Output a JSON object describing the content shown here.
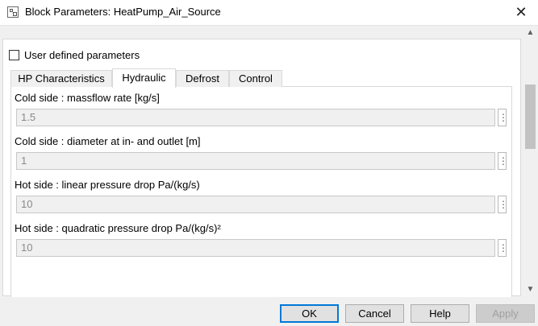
{
  "window": {
    "title": "Block Parameters: HeatPump_Air_Source",
    "close_glyph": "✕"
  },
  "checkbox": {
    "label": "User defined parameters",
    "checked": false
  },
  "tabs": [
    {
      "label": "HP Characteristics",
      "active": false
    },
    {
      "label": "Hydraulic",
      "active": true
    },
    {
      "label": "Defrost",
      "active": false
    },
    {
      "label": "Control",
      "active": false
    }
  ],
  "fields": [
    {
      "label": "Cold side : massflow rate [kg/s]",
      "value": "1.5"
    },
    {
      "label": "Cold side : diameter at in- and outlet [m]",
      "value": "1"
    },
    {
      "label": "Hot side : linear pressure drop Pa/(kg/s)",
      "value": "10"
    },
    {
      "label": "Hot side : quadratic pressure drop Pa/(kg/s)²",
      "value": "10"
    }
  ],
  "field_menu_glyph": "⋮",
  "buttons": {
    "ok": {
      "label": "OK"
    },
    "cancel": {
      "label": "Cancel"
    },
    "help": {
      "label": "Help"
    },
    "apply": {
      "label": "Apply"
    }
  },
  "scrollbar": {
    "up_glyph": "▲",
    "down_glyph": "▼"
  },
  "icons": {
    "window": "block-parameters-icon"
  },
  "colors": {
    "default_button_border": "#0078d7",
    "window_bg": "#f0f0f0"
  }
}
